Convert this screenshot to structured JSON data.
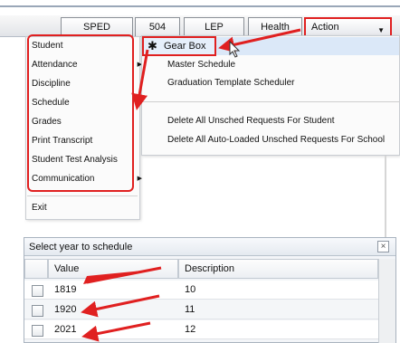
{
  "tabs": [
    "SPED",
    "504",
    "LEP",
    "Health"
  ],
  "action_tab": "Action",
  "main_menu": [
    {
      "label": "Student",
      "submenu": false
    },
    {
      "label": "Attendance",
      "submenu": true
    },
    {
      "label": "Discipline",
      "submenu": false
    },
    {
      "label": "Schedule",
      "submenu": true
    },
    {
      "label": "Grades",
      "submenu": false
    },
    {
      "label": "Print Transcript",
      "submenu": false
    },
    {
      "label": "Student Test Analysis",
      "submenu": false
    },
    {
      "label": "Communication",
      "submenu": true
    }
  ],
  "exit_label": "Exit",
  "schedule_submenu": {
    "gear_box": "Gear Box",
    "items": [
      "Master Schedule",
      "Graduation Template Scheduler"
    ],
    "delete_items": [
      "Delete All Unsched Requests For Student",
      "Delete All Auto-Loaded Unsched Requests For School"
    ]
  },
  "dialog": {
    "title": "Select year to schedule",
    "close": "×",
    "columns": [
      "Value",
      "Description"
    ],
    "rows": [
      {
        "value": "1819",
        "description": "10"
      },
      {
        "value": "1920",
        "description": "11"
      },
      {
        "value": "2021",
        "description": "12"
      }
    ]
  },
  "colors": {
    "annotation": "#e02020",
    "highlight": "#dbe8f8"
  }
}
